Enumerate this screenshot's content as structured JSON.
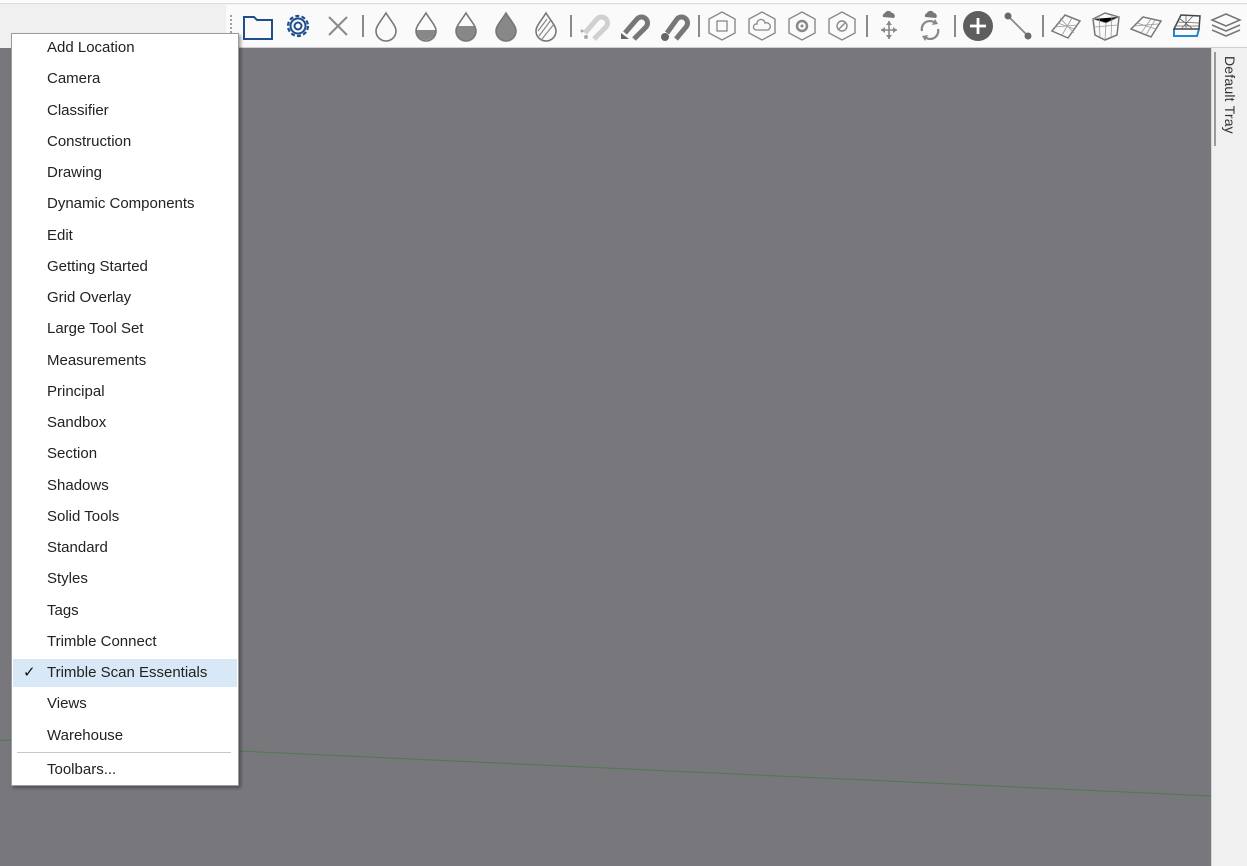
{
  "toolbar": {
    "icons": [
      "folder-icon",
      "gear-icon",
      "close-icon",
      "drop-empty-icon",
      "drop-half-icon",
      "drop-mostly-icon",
      "drop-full-icon",
      "drop-hatched-icon",
      "magnet-faded-icon",
      "magnet-icon",
      "magnet-ball-icon",
      "cube-square-icon",
      "cube-cloud-icon",
      "cube-spiral-icon",
      "cube-slash-icon",
      "move-arrows-icon",
      "rotate-cloud-icon",
      "add-circle-icon",
      "measure-line-icon",
      "mesh-wire-icon",
      "mesh-box-icon",
      "mesh-flat-icon",
      "mesh-active-icon",
      "layers-icon"
    ]
  },
  "tray": {
    "label": "Default Tray"
  },
  "menu": {
    "items": [
      {
        "label": "Add Location",
        "checked": false
      },
      {
        "label": "Camera",
        "checked": false
      },
      {
        "label": "Classifier",
        "checked": false
      },
      {
        "label": "Construction",
        "checked": false
      },
      {
        "label": "Drawing",
        "checked": false
      },
      {
        "label": "Dynamic Components",
        "checked": false
      },
      {
        "label": "Edit",
        "checked": false
      },
      {
        "label": "Getting Started",
        "checked": false
      },
      {
        "label": "Grid Overlay",
        "checked": false
      },
      {
        "label": "Large Tool Set",
        "checked": false
      },
      {
        "label": "Measurements",
        "checked": false
      },
      {
        "label": "Principal",
        "checked": false
      },
      {
        "label": "Sandbox",
        "checked": false
      },
      {
        "label": "Section",
        "checked": false
      },
      {
        "label": "Shadows",
        "checked": false
      },
      {
        "label": "Solid Tools",
        "checked": false
      },
      {
        "label": "Standard",
        "checked": false
      },
      {
        "label": "Styles",
        "checked": false
      },
      {
        "label": "Tags",
        "checked": false
      },
      {
        "label": "Trimble Connect",
        "checked": false
      },
      {
        "label": "Trimble Scan Essentials",
        "checked": true
      },
      {
        "label": "Views",
        "checked": false
      },
      {
        "label": "Warehouse",
        "checked": false
      }
    ],
    "footer_label": "Toolbars...",
    "check_mark": "✓"
  },
  "colors": {
    "viewport_bg": "#78777c",
    "selection_bg": "#d8e8f6",
    "accent_blue": "#1e88d6",
    "ground_line": "#4e7a4e"
  }
}
